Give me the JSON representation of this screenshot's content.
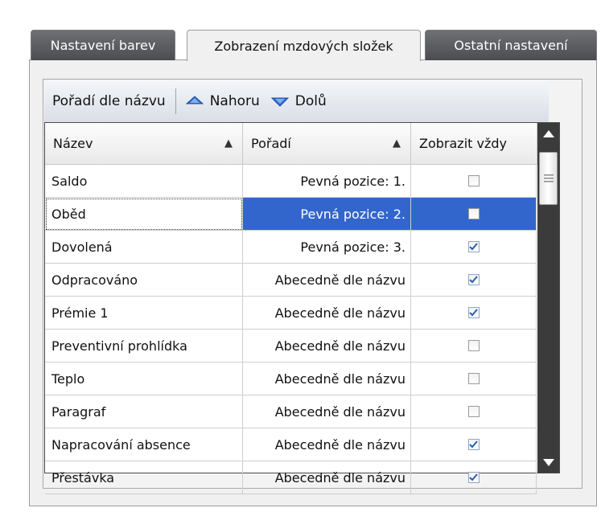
{
  "tabs": [
    {
      "label": "Nastavení barev",
      "active": false
    },
    {
      "label": "Zobrazení mzdových složek",
      "active": true
    },
    {
      "label": "Ostatní nastavení",
      "active": false
    }
  ],
  "toolbar": {
    "sort_label": "Pořadí dle názvu",
    "up_label": "Nahoru",
    "down_label": "Dolů"
  },
  "grid": {
    "columns": [
      {
        "label": "Název",
        "sort": "▲"
      },
      {
        "label": "Pořadí",
        "sort": "▲"
      },
      {
        "label": "Zobrazit vždy"
      }
    ],
    "rows": [
      {
        "name": "Saldo",
        "order": "Pevná pozice: 1.",
        "show_always": false
      },
      {
        "name": "Oběd",
        "order": "Pevná pozice: 2.",
        "show_always": false
      },
      {
        "name": "Dovolená",
        "order": "Pevná pozice: 3.",
        "show_always": true
      },
      {
        "name": "Odpracováno",
        "order": "Abecedně dle názvu",
        "show_always": true
      },
      {
        "name": "Prémie 1",
        "order": "Abecedně dle názvu",
        "show_always": true
      },
      {
        "name": "Preventivní prohlídka",
        "order": "Abecedně dle názvu",
        "show_always": false
      },
      {
        "name": "Teplo",
        "order": "Abecedně dle názvu",
        "show_always": false
      },
      {
        "name": "Paragraf",
        "order": "Abecedně dle názvu",
        "show_always": false
      },
      {
        "name": "Napracování absence",
        "order": "Abecedně dle názvu",
        "show_always": true
      },
      {
        "name": "Přestávka",
        "order": "Abecedně dle názvu",
        "show_always": true
      }
    ],
    "selected_row": 1
  },
  "colors": {
    "selection": "#3366cc",
    "tab_inactive": "#5a5b5e",
    "arrow_icon": "#2f6fd6",
    "scrollbar": "#3b3b3b"
  },
  "icons": {
    "up": "arrow-up-icon",
    "down": "arrow-down-icon",
    "sort": "sort-ascending-icon",
    "check": "checkmark-icon"
  }
}
